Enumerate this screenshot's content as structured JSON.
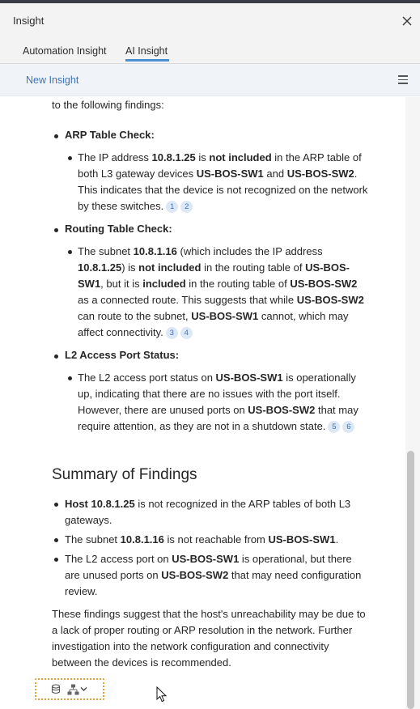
{
  "panel": {
    "title": "Insight",
    "close_icon": "close-icon"
  },
  "tabs": [
    {
      "label": "Automation Insight",
      "active": false
    },
    {
      "label": "AI Insight",
      "active": true
    }
  ],
  "subheader": {
    "new_insight_label": "New Insight",
    "menu_icon": "hamburger-menu-icon"
  },
  "content": {
    "intro": "to the following findings:",
    "sections": [
      {
        "heading": "ARP Table Check:",
        "bullet": {
          "t1": "The IP address ",
          "b1": "10.8.1.25",
          "t2": " is ",
          "b2": "not included",
          "t3": " in the ARP table of both L3 gateway devices ",
          "b3": "US-BOS-SW1",
          "t4": " and ",
          "b4": "US-BOS-SW2",
          "t5": ". This indicates that the device is not recognized on the network by these switches.",
          "refs": [
            "1",
            "2"
          ]
        }
      },
      {
        "heading": "Routing Table Check:",
        "bullet": {
          "t1": "The subnet ",
          "b1": "10.8.1.16",
          "t2": " (which includes the IP address ",
          "b2": "10.8.1.25",
          "t3": ") is ",
          "b3": "not included",
          "t4": " in the routing table of ",
          "b4": "US-BOS-SW1",
          "t5": ", but it is ",
          "b5": "included",
          "t6": " in the routing table of ",
          "b6": "US-BOS-SW2",
          "t7": " as a connected route. This suggests that while ",
          "b7": "US-BOS-SW2",
          "t8": " can route to the subnet, ",
          "b8": "US-BOS-SW1",
          "t9": " cannot, which may affect connectivity.",
          "refs": [
            "3",
            "4"
          ]
        }
      },
      {
        "heading": "L2 Access Port Status:",
        "bullet": {
          "t1": "The L2 access port status on ",
          "b1": "US-BOS-SW1",
          "t2": " is operationally up, indicating that there are no issues with the port itself. However, there are unused ports on ",
          "b2": "US-BOS-SW2",
          "t3": " that may require attention, as they are not in a shutdown state.",
          "refs": [
            "5",
            "6"
          ]
        }
      }
    ],
    "summary": {
      "heading": "Summary of Findings",
      "items": [
        {
          "b1": "Host 10.8.1.25",
          "t1": " is not recognized in the ARP tables of both L3 gateways."
        },
        {
          "t0": "The subnet ",
          "b1": "10.8.1.16",
          "t1": " is not reachable from ",
          "b2": "US-BOS-SW1",
          "t2": "."
        },
        {
          "t0": "The L2 access port on ",
          "b1": "US-BOS-SW1",
          "t1": " is operational, but there are unused ports on ",
          "b2": "US-BOS-SW2",
          "t2": " that may need configuration review."
        }
      ],
      "conclusion": "These findings suggest that the host's unreachability may be due to a lack of proper routing or ARP resolution in the network. Further investigation into the network configuration and connectivity between the devices is recommended."
    }
  },
  "toolbar": {
    "icons": [
      "database-icon",
      "topology-icon",
      "chevron-down-icon"
    ]
  },
  "colors": {
    "accent": "#4a8fd3",
    "link": "#3b73b9",
    "subheader_bg": "#f0f4f9",
    "toolbar_border": "#e2a23b"
  }
}
